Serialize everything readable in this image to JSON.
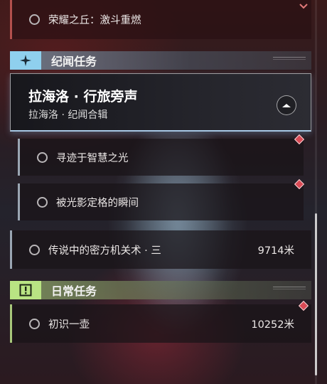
{
  "top_item": {
    "label": "荣耀之丘：激斗重燃"
  },
  "section_legend": {
    "title": "纪闻任务",
    "icon": "sparkle-icon",
    "accent": "#8fd0ee"
  },
  "featured_quest": {
    "title": "拉海洛 · 行旅旁声",
    "subtitle": "拉海洛 · 纪闻合辑",
    "toggle_icon": "collapse-icon"
  },
  "legend_items": [
    {
      "label": "寻迹于智慧之光",
      "marker": "diamond-marker"
    },
    {
      "label": "被光影定格的瞬间",
      "marker": "diamond-marker"
    }
  ],
  "legend_extra": {
    "label": "传说中的密方机关术 · 三",
    "distance": "9714米"
  },
  "section_daily": {
    "title": "日常任务",
    "icon": "exclamation-icon",
    "accent": "#b9e483"
  },
  "daily_items": [
    {
      "label": "初识一壶",
      "distance": "10252米",
      "marker": "diamond-marker"
    }
  ]
}
